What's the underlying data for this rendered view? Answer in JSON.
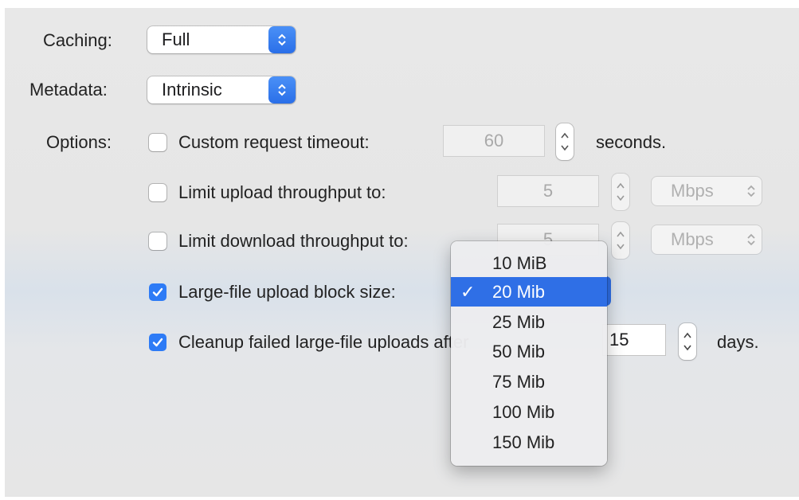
{
  "labels": {
    "caching": "Caching:",
    "metadata": "Metadata:",
    "options": "Options:"
  },
  "caching_value": "Full",
  "metadata_value": "Intrinsic",
  "options": {
    "timeout": {
      "label": "Custom request timeout:",
      "value": "60",
      "suffix": "seconds.",
      "checked": false
    },
    "upload": {
      "label": "Limit upload throughput to:",
      "value": "5",
      "unit": "Mbps",
      "checked": false
    },
    "download": {
      "label": "Limit download throughput to:",
      "value": "5",
      "unit": "Mbps",
      "checked": false
    },
    "blocksize": {
      "label": "Large-file upload block size:",
      "checked": true
    },
    "cleanup": {
      "label": "Cleanup failed large-file uploads after",
      "value": "15",
      "suffix": "days.",
      "checked": true
    }
  },
  "menu": {
    "items": [
      "10 MiB",
      "20 Mib",
      "25 Mib",
      "50 Mib",
      "75 Mib",
      "100 Mib",
      "150 Mib"
    ],
    "selected": "20 Mib",
    "check_glyph": "✓"
  },
  "colors": {
    "accent": "#2d7bf6",
    "menu_highlight": "#2f6fe6"
  }
}
